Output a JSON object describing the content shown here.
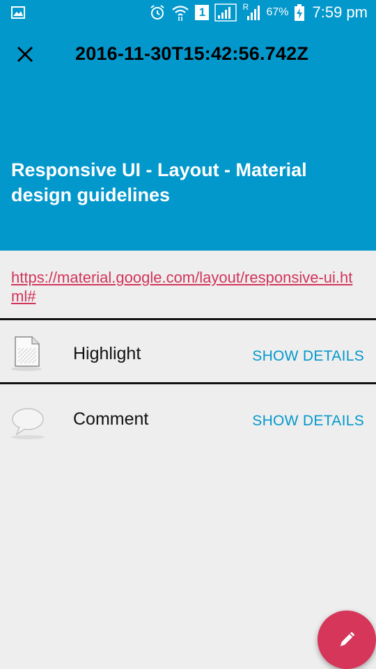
{
  "status_bar": {
    "sim_badge": "1",
    "roaming_label": "R",
    "battery": "67%",
    "time": "7:59 pm"
  },
  "toolbar": {
    "title": "2016-11-30T15:42:56.742Z",
    "close_icon": "close-icon"
  },
  "header": {
    "title": "Responsive UI - Layout - Material design guidelines"
  },
  "link": {
    "url": "https://material.google.com/layout/responsive-ui.html#"
  },
  "rows": [
    {
      "label": "Highlight",
      "action": "SHOW DETAILS",
      "icon": "document-icon"
    },
    {
      "label": "Comment",
      "action": "SHOW DETAILS",
      "icon": "speech-bubble-icon"
    }
  ],
  "fab": {
    "icon": "pencil-icon"
  },
  "colors": {
    "primary": "#0398cc",
    "accent": "#d6365a",
    "link": "#d2345a",
    "background": "#eeeeee"
  }
}
